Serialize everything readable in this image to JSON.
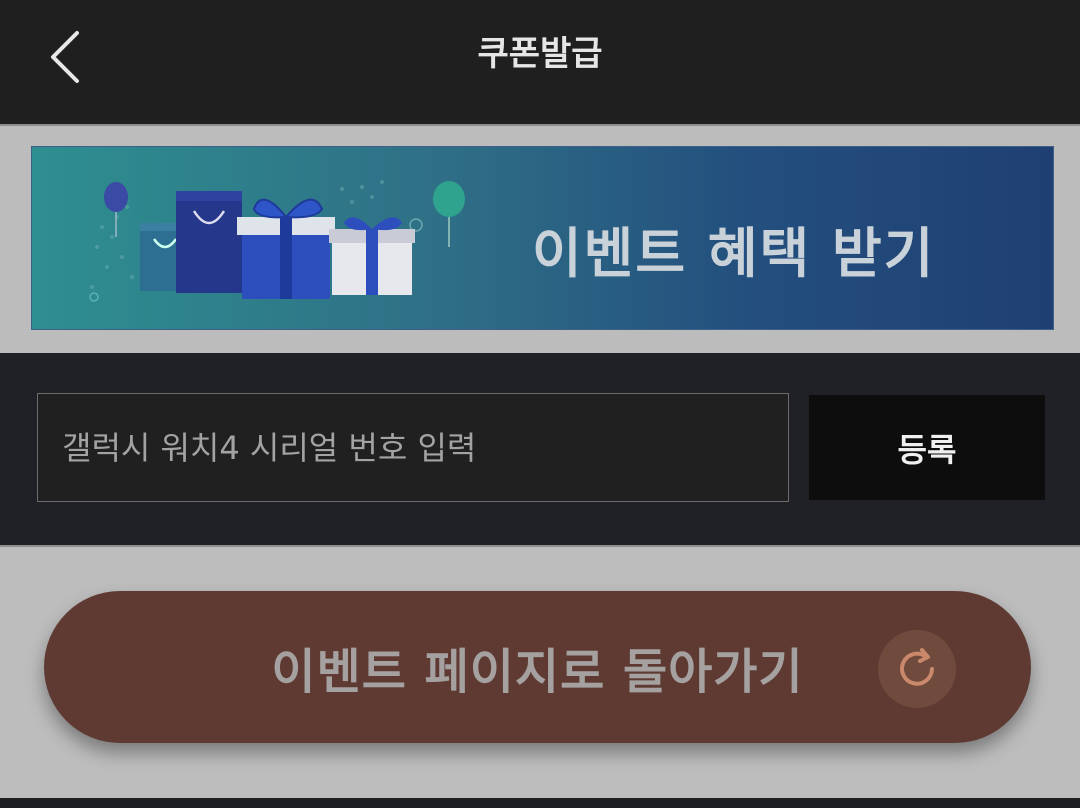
{
  "header": {
    "title": "쿠폰발급",
    "back_icon": "chevron-left-icon"
  },
  "banner": {
    "text": "이벤트 혜택 받기",
    "art": "gift-boxes-and-shopping-bags-illustration"
  },
  "serial_form": {
    "placeholder": "갤럭시 워치4 시리얼 번호 입력",
    "value": "",
    "register_label": "등록"
  },
  "return_button": {
    "label": "이벤트 페이지로 돌아가기",
    "icon": "refresh-icon"
  },
  "colors": {
    "header_bg": "#1f1f1f",
    "banner_gradient_start": "#2e8f90",
    "banner_gradient_end": "#1f3f72",
    "return_button_bg": "#5f3a33",
    "register_bg": "#0d0d0d"
  }
}
